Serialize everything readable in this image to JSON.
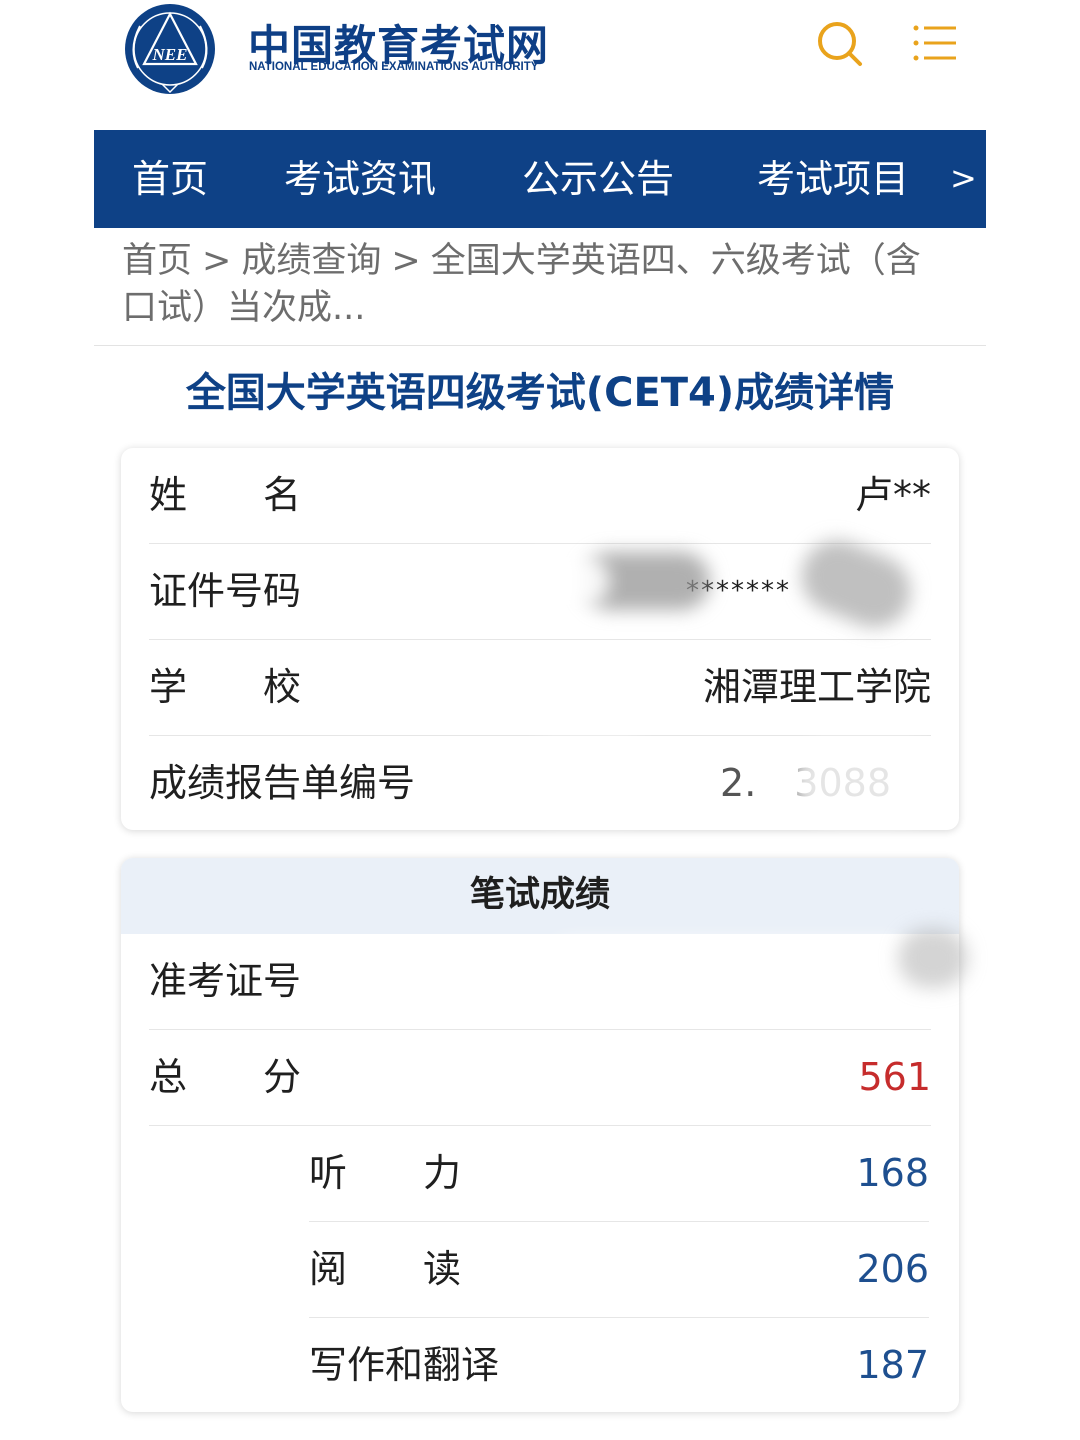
{
  "header": {
    "site_title": "中国教育考试网",
    "site_subtitle": "NATIONAL EDUCATION EXAMINATIONS AUTHORITY",
    "emblem_text": "NEE",
    "icons": [
      "search-icon",
      "menu-icon"
    ]
  },
  "nav": {
    "items": [
      {
        "label": "首页"
      },
      {
        "label": "考试资讯"
      },
      {
        "label": "公示公告"
      },
      {
        "label": "考试项目"
      }
    ],
    "more": ">"
  },
  "breadcrumb": {
    "items": [
      "首页",
      "成绩查询",
      "全国大学英语四、六级考试（含口试）当次成..."
    ],
    "separator": ">"
  },
  "page_title": "全国大学英语四级考试(CET4)成绩详情",
  "info": {
    "name_label": "姓　　名",
    "name_value": "卢**",
    "id_label": "证件号码",
    "id_value": "*******",
    "school_label": "学　　校",
    "school_value": "湘潭理工学院",
    "report_label": "成绩报告单编号",
    "report_value": "2.　3088"
  },
  "written": {
    "heading": "笔试成绩",
    "ticket_label": "准考证号",
    "ticket_value": "",
    "total_label": "总　　分",
    "total_value": "561",
    "listening_label": "听　　力",
    "listening_value": "168",
    "reading_label": "阅　　读",
    "reading_value": "206",
    "writing_label": "写作和翻译",
    "writing_value": "187"
  },
  "colors": {
    "brand_blue": "#0e4186",
    "total_red": "#c62c2c",
    "part_blue": "#1e4f8f",
    "accent_gold": "#e9a31c"
  }
}
